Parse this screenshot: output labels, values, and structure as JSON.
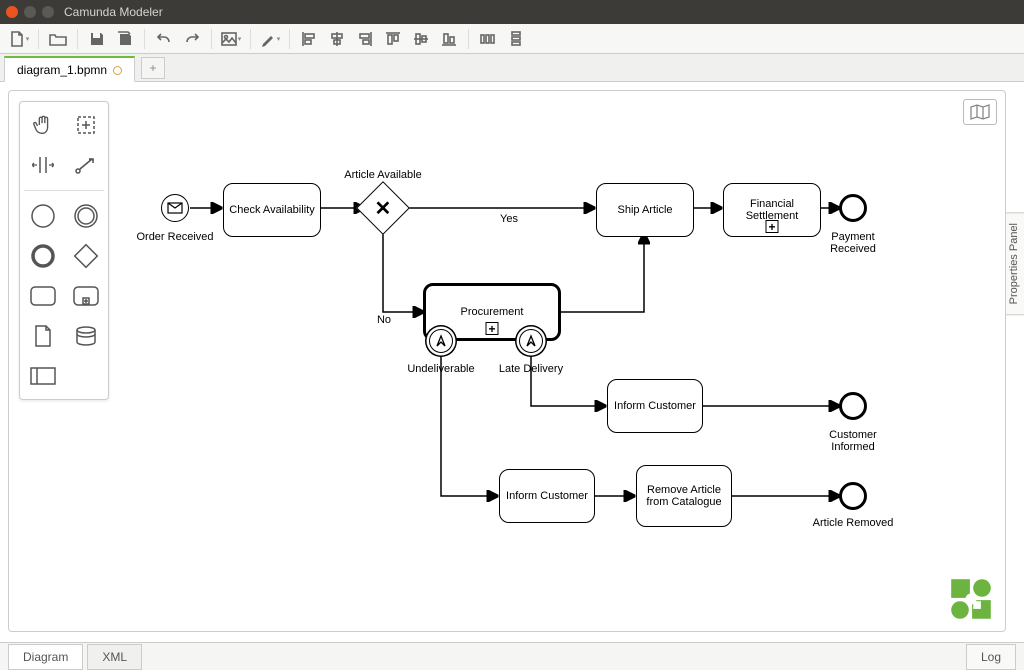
{
  "window": {
    "title": "Camunda Modeler"
  },
  "tabs": {
    "file": "diagram_1.bpmn"
  },
  "footer": {
    "diagram": "Diagram",
    "xml": "XML",
    "log": "Log"
  },
  "props_panel": "Properties Panel",
  "toolbar": {
    "new": "new-file",
    "open": "open-file",
    "save": "save",
    "saveall": "save-all",
    "undo": "undo",
    "redo": "redo",
    "image": "picture",
    "color": "color",
    "align_l": "align-left",
    "align_c": "align-center",
    "align_r": "align-right",
    "align_t": "align-top",
    "align_m": "align-middle",
    "align_b": "align-bottom",
    "dist_h": "distribute-horizontal",
    "dist_v": "distribute-vertical"
  },
  "palette": {
    "hand": "hand-tool",
    "lasso": "lasso-tool",
    "space": "space-tool",
    "connect": "connect-tool",
    "start_event": "start-event",
    "int_event": "intermediate-event",
    "end_event": "end-event",
    "gateway": "exclusive-gateway",
    "task": "task",
    "subprocess": "subprocess",
    "data_obj": "data-object",
    "data_store": "data-store",
    "pool": "participant"
  },
  "diagram": {
    "start_label": "Order Received",
    "task_check": "Check Availability",
    "gw_label": "Article Available",
    "yes": "Yes",
    "no": "No",
    "task_ship": "Ship Article",
    "task_fin": "Financial Settlement",
    "end_pay": "Payment Received",
    "task_proc": "Procurement",
    "bnd_undeliv": "Undeliverable",
    "bnd_late": "Late Delivery",
    "task_inform1": "Inform Customer",
    "end_informed": "Customer Informed",
    "task_inform2": "Inform Customer",
    "task_remove": "Remove Article from Catalogue",
    "end_removed": "Article Removed"
  }
}
